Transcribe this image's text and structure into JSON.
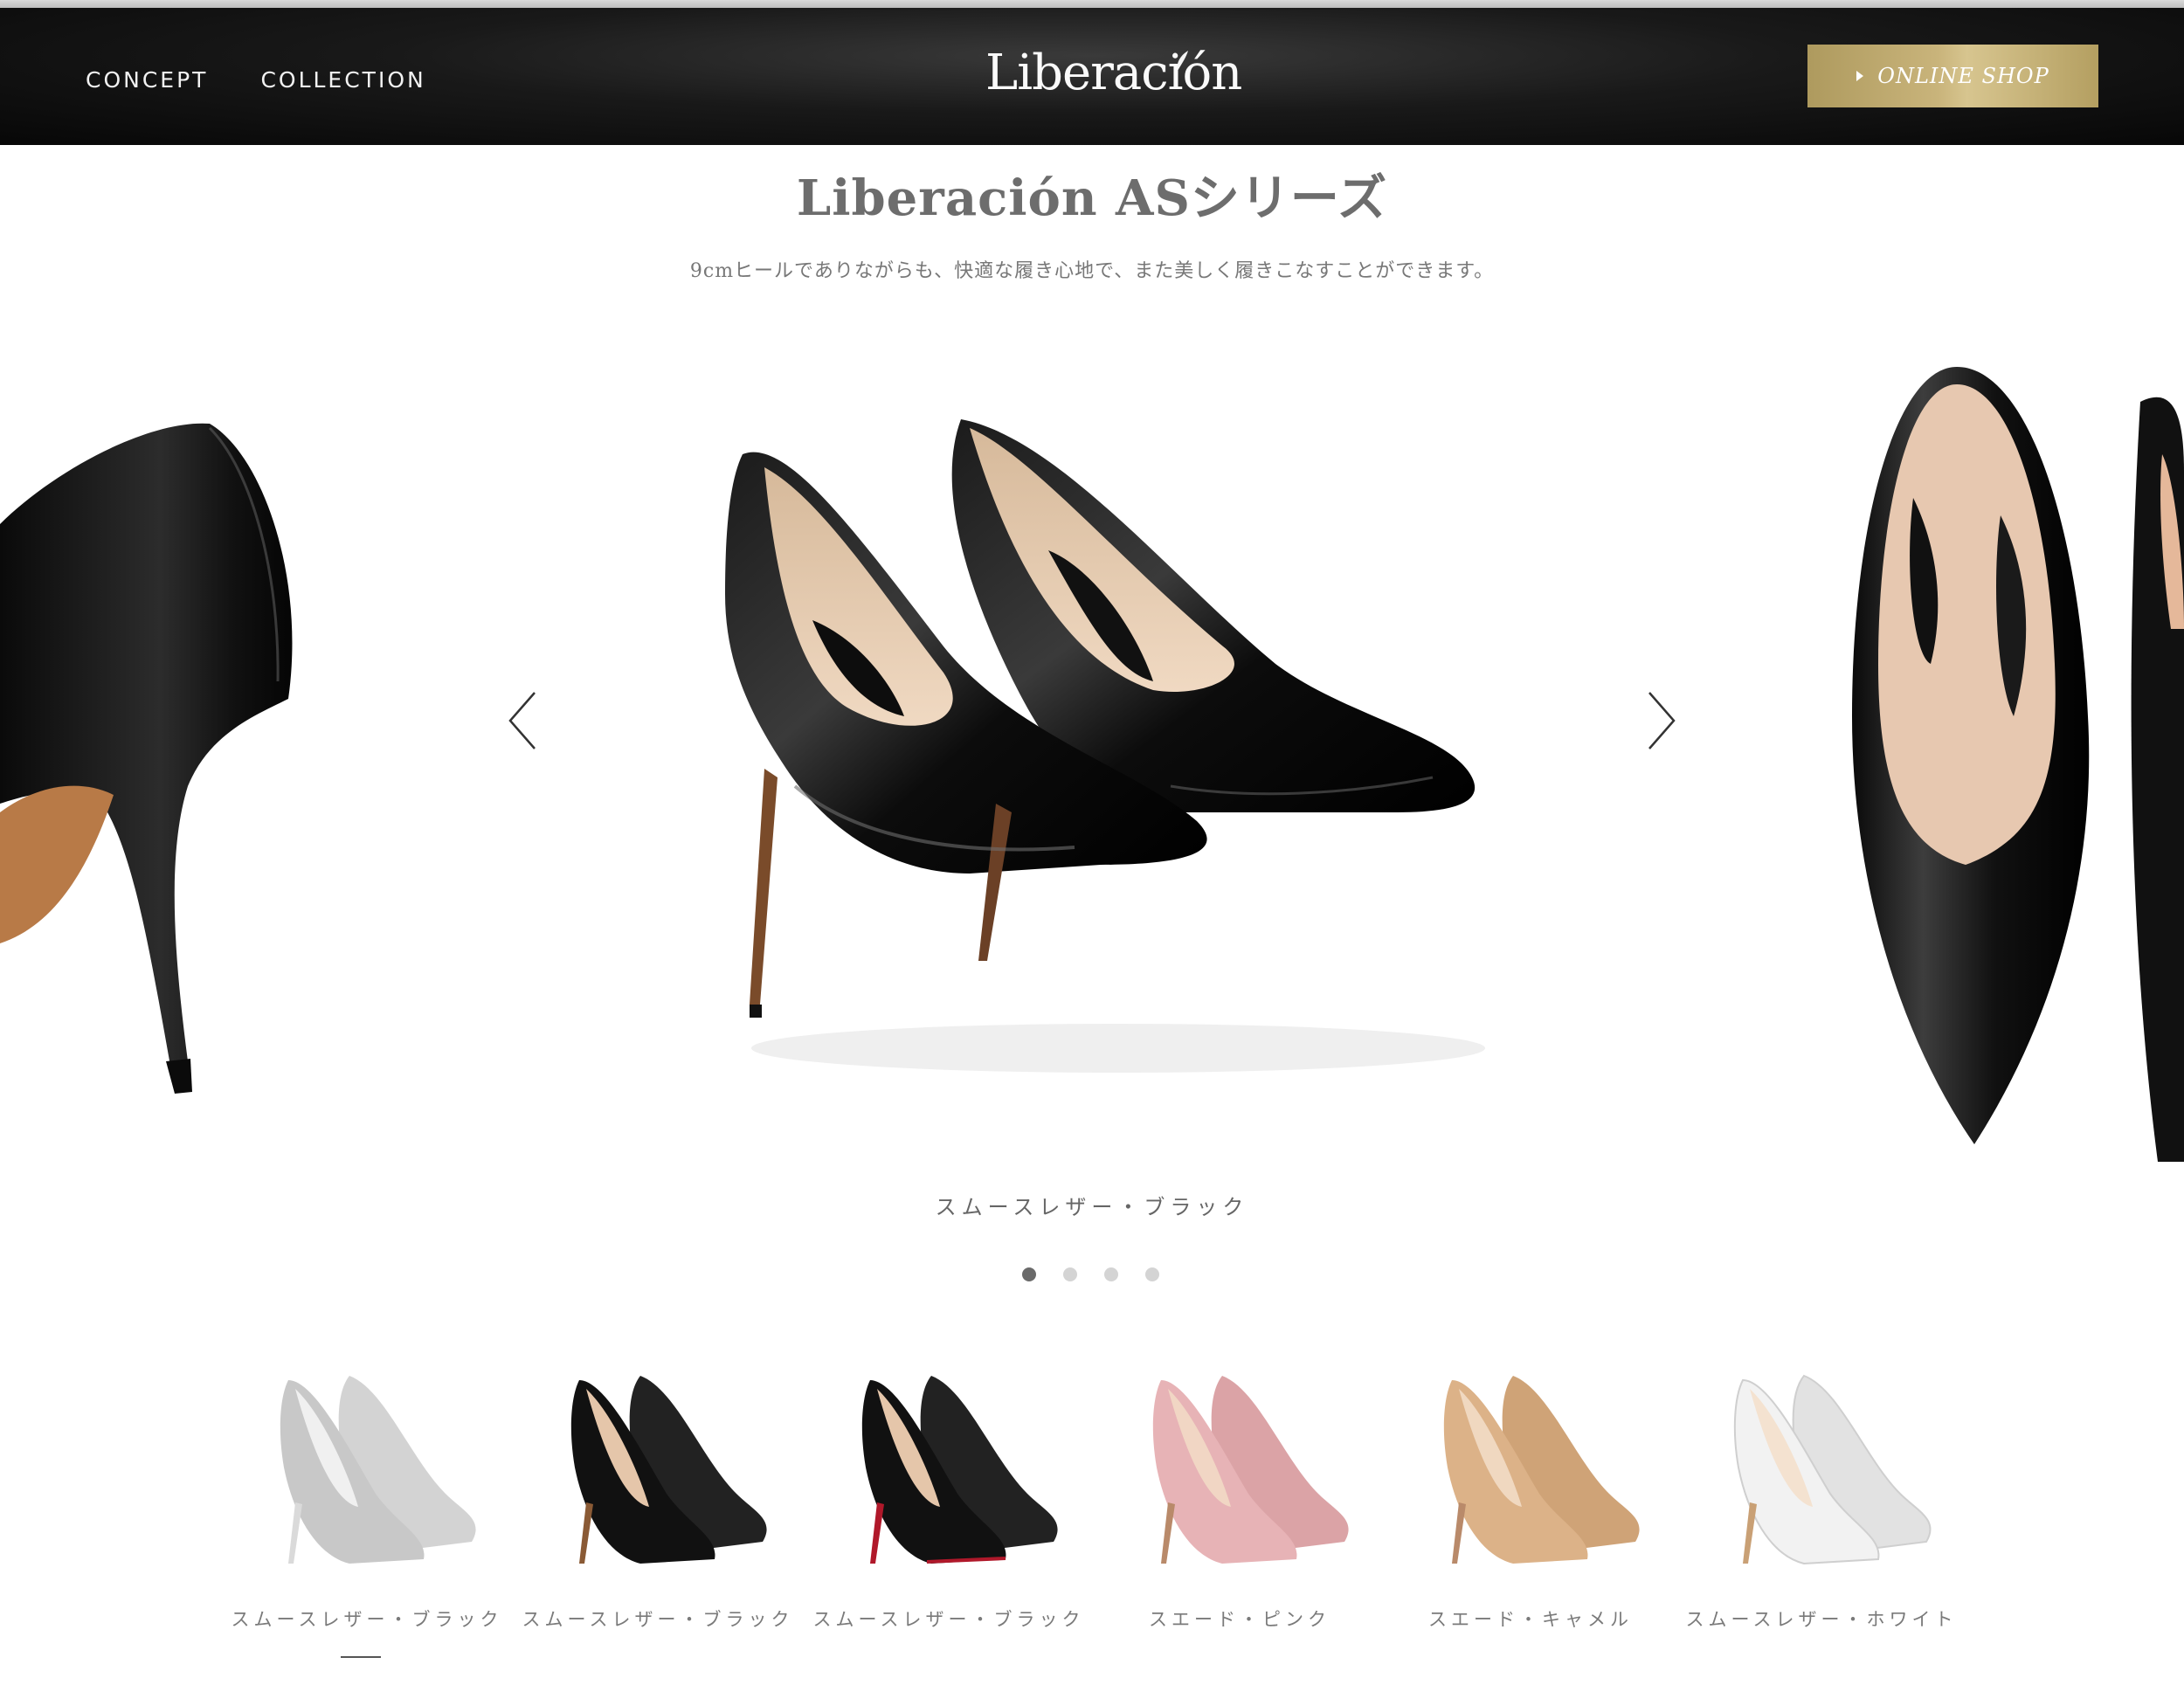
{
  "header": {
    "nav": [
      {
        "label": "CONCEPT"
      },
      {
        "label": "COLLECTION"
      }
    ],
    "logo": "Liberación",
    "shop_button": "ONLINE SHOP"
  },
  "main": {
    "title": "Liberación ASシリーズ",
    "subtitle": "9cmヒールでありながらも、快適な履き心地で、また美しく履きこなすことができます。"
  },
  "carousel": {
    "caption": "スムースレザー・ブラック",
    "total_slides": 4,
    "active_index": 0
  },
  "thumbnails": [
    {
      "label": "スムースレザー・ブラック",
      "color": "#2a2a2a",
      "sole": "#a9a9a9",
      "state": "selected"
    },
    {
      "label": "スムースレザー・ブラック",
      "color": "#1d1d1d",
      "sole": "#8a5a35"
    },
    {
      "label": "スムースレザー・ブラック",
      "color": "#1d1d1d",
      "sole": "#b0182a"
    },
    {
      "label": "スエード・ピンク",
      "color": "#e3aeb1",
      "sole": "#b98a6a"
    },
    {
      "label": "スエード・キャメル",
      "color": "#d9ae82",
      "sole": "#b98a6a"
    },
    {
      "label": "スムースレザー・ホワイト",
      "color": "#ececec",
      "sole": "#c9a075"
    }
  ]
}
